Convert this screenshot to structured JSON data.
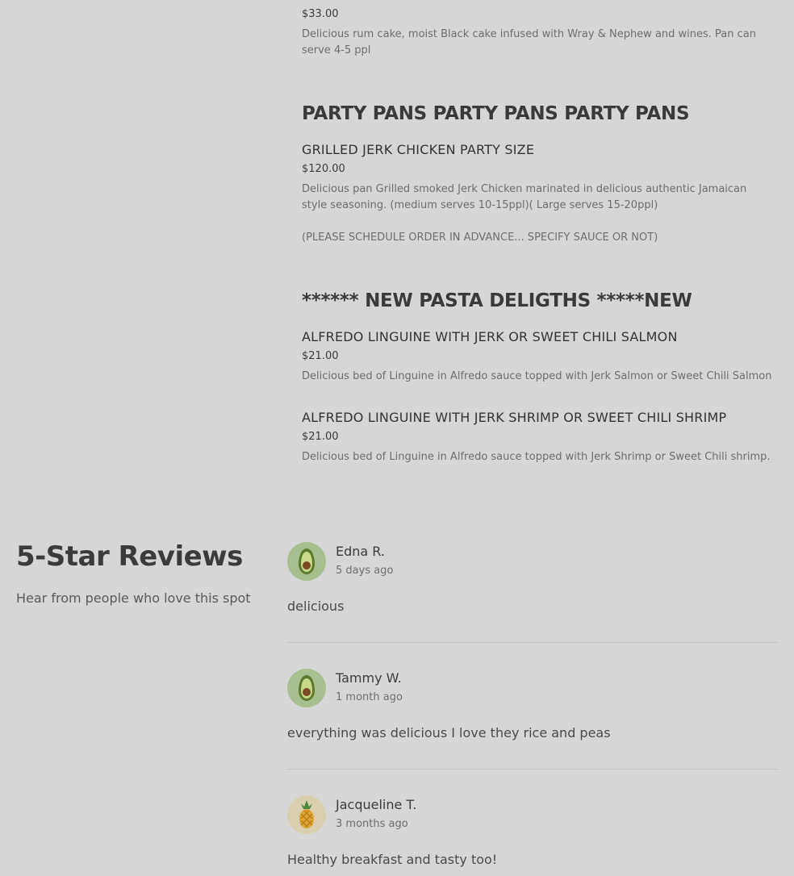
{
  "menu": {
    "top_item": {
      "price": "$33.00",
      "description": "Delicious rum cake, moist Black cake infused with Wray & Nephew and wines. Pan can serve 4-5 ppl"
    },
    "party_pans": {
      "title": "PARTY PANS PARTY PANS PARTY PANS",
      "items": [
        {
          "name": "GRILLED JERK CHICKEN PARTY SIZE",
          "price": "$120.00",
          "description": "Delicious pan Grilled smoked Jerk Chicken marinated in delicious authentic Jamaican style seasoning. (medium serves 10-15ppl)( Large serves 15-20ppl)",
          "note": "(PLEASE SCHEDULE ORDER IN ADVANCE... SPECIFY SAUCE OR NOT)"
        }
      ]
    },
    "pasta": {
      "title": "****** NEW PASTA DELIGTHS *****NEW",
      "items": [
        {
          "name": "ALFREDO LINGUINE WITH JERK OR SWEET CHILI SALMON",
          "price": "$21.00",
          "description": "Delicious bed of Linguine in Alfredo sauce topped with Jerk Salmon or Sweet Chili Salmon"
        },
        {
          "name": "ALFREDO LINGUINE WITH JERK SHRIMP OR SWEET CHILI SHRIMP",
          "price": "$21.00",
          "description": "Delicious bed of Linguine in Alfredo sauce topped with Jerk Shrimp or Sweet Chili shrimp."
        }
      ]
    }
  },
  "reviews": {
    "title": "5-Star Reviews",
    "subtitle": "Hear from people who love this spot",
    "list": [
      {
        "name": "Edna R.",
        "date": "5 days ago",
        "text": "delicious",
        "avatar_icon": "avocado-icon"
      },
      {
        "name": "Tammy W.",
        "date": "1 month ago",
        "text": "everything was delicious I love they rice and peas",
        "avatar_icon": "avocado-icon"
      },
      {
        "name": "Jacqueline T.",
        "date": "3 months ago",
        "text": "Healthy breakfast and tasty too!",
        "avatar_icon": "pineapple-icon"
      }
    ]
  },
  "colors": {
    "page_background": "#d6d6d6",
    "avocado_bg": "#a8c08f",
    "pineapple_bg": "#d9cfae"
  }
}
